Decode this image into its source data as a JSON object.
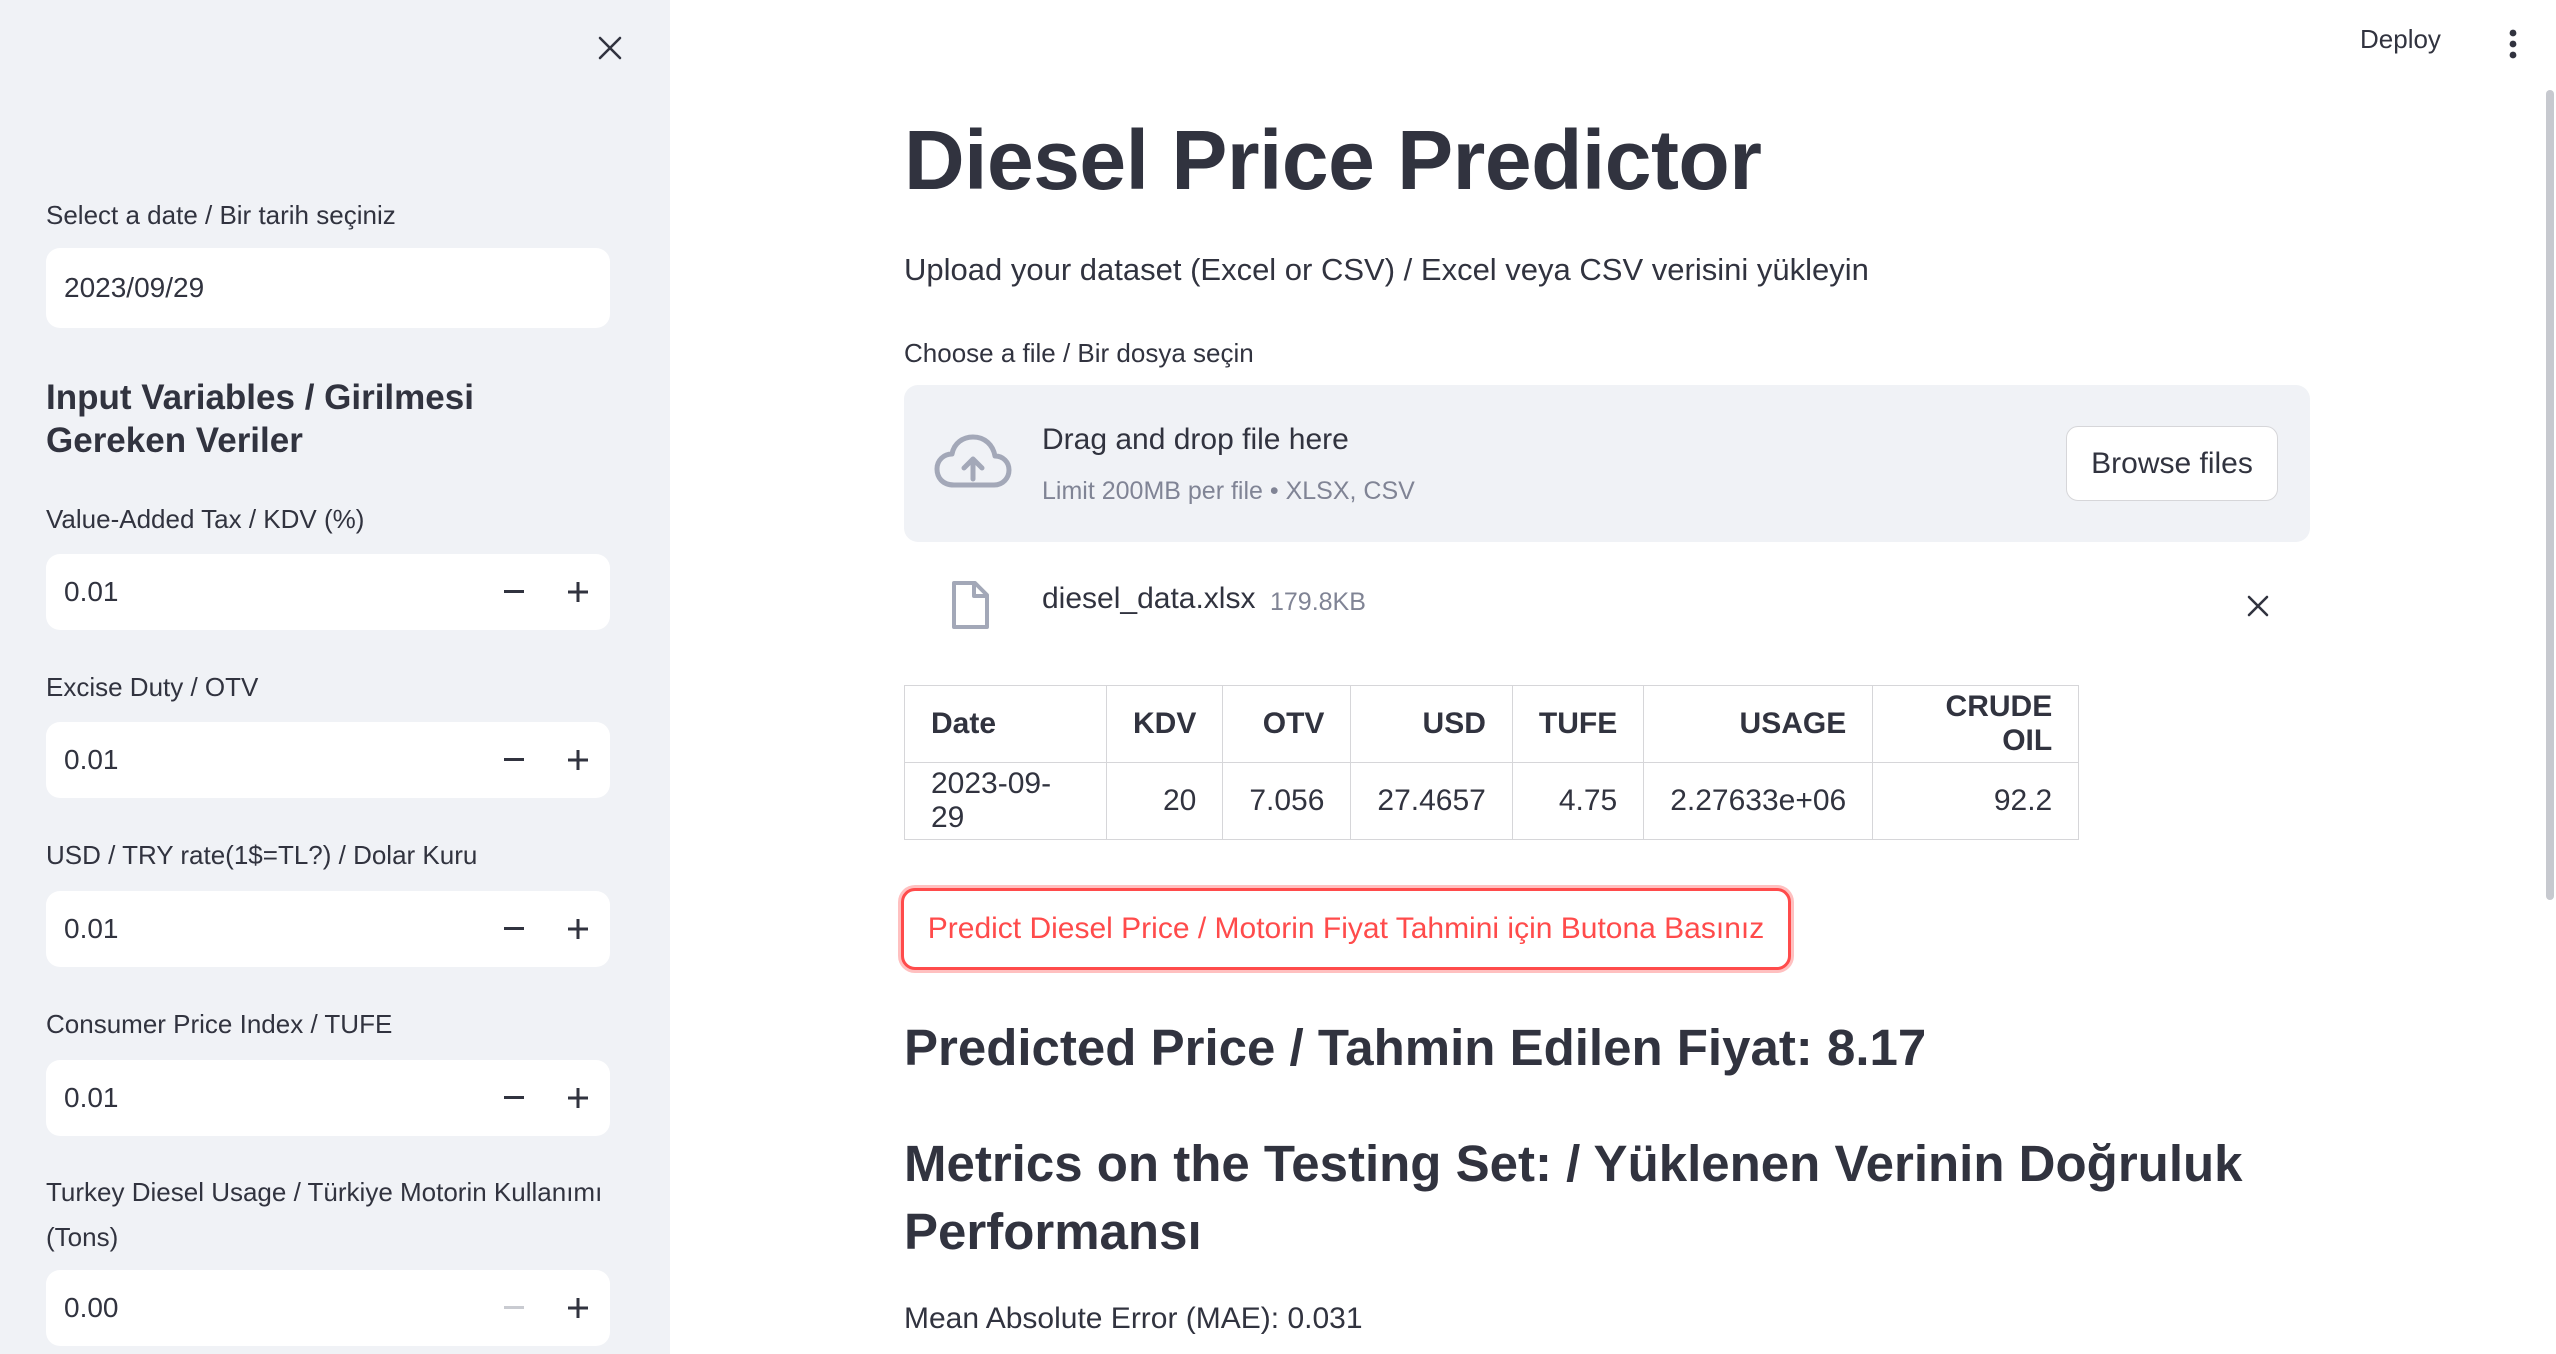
{
  "header": {
    "deploy_label": "Deploy"
  },
  "sidebar": {
    "date": {
      "label": "Select a date / Bir tarih seçiniz",
      "value": "2023/09/29"
    },
    "section_heading": "Input Variables / Girilmesi Gereken Veriler",
    "inputs": [
      {
        "label": "Value-Added Tax / KDV (%)",
        "value": "0.01"
      },
      {
        "label": "Excise Duty / OTV",
        "value": "0.01"
      },
      {
        "label": "USD / TRY rate(1$=TL?) / Dolar Kuru",
        "value": "0.01"
      },
      {
        "label": "Consumer Price Index / TUFE",
        "value": "0.01"
      },
      {
        "label": "Turkey Diesel Usage / Türkiye Motorin Kullanımı (Tons)",
        "value": "0.00"
      }
    ]
  },
  "main": {
    "title": "Diesel Price Predictor",
    "subtitle": "Upload your dataset (Excel or CSV) / Excel veya CSV verisini yükleyin",
    "uploader": {
      "label": "Choose a file / Bir dosya seçin",
      "drag_text": "Drag and drop file here",
      "limit_text": "Limit 200MB per file • XLSX, CSV",
      "browse_label": "Browse files"
    },
    "file": {
      "name": "diesel_data.xlsx",
      "size": "179.8KB"
    },
    "table": {
      "columns": [
        "Date",
        "KDV",
        "OTV",
        "USD",
        "TUFE",
        "USAGE",
        "CRUDE OIL"
      ],
      "rows": [
        [
          "2023-09-29",
          "20",
          "7.056",
          "27.4657",
          "4.75",
          "2.27633e+06",
          "92.2"
        ]
      ]
    },
    "predict_button": "Predict Diesel Price / Motorin Fiyat Tahmini için Butona Basınız",
    "predicted_text": "Predicted Price / Tahmin Edilen Fiyat: 8.17",
    "metrics_heading": "Metrics on the Testing Set: / Yüklenen Verinin Doğruluk Performansı",
    "mae_text": "Mean Absolute Error (MAE): 0.031"
  },
  "colors": {
    "sidebar_bg": "#f0f2f6",
    "text": "#31333f",
    "accent_red": "#ff4b4b",
    "muted": "#808495"
  }
}
